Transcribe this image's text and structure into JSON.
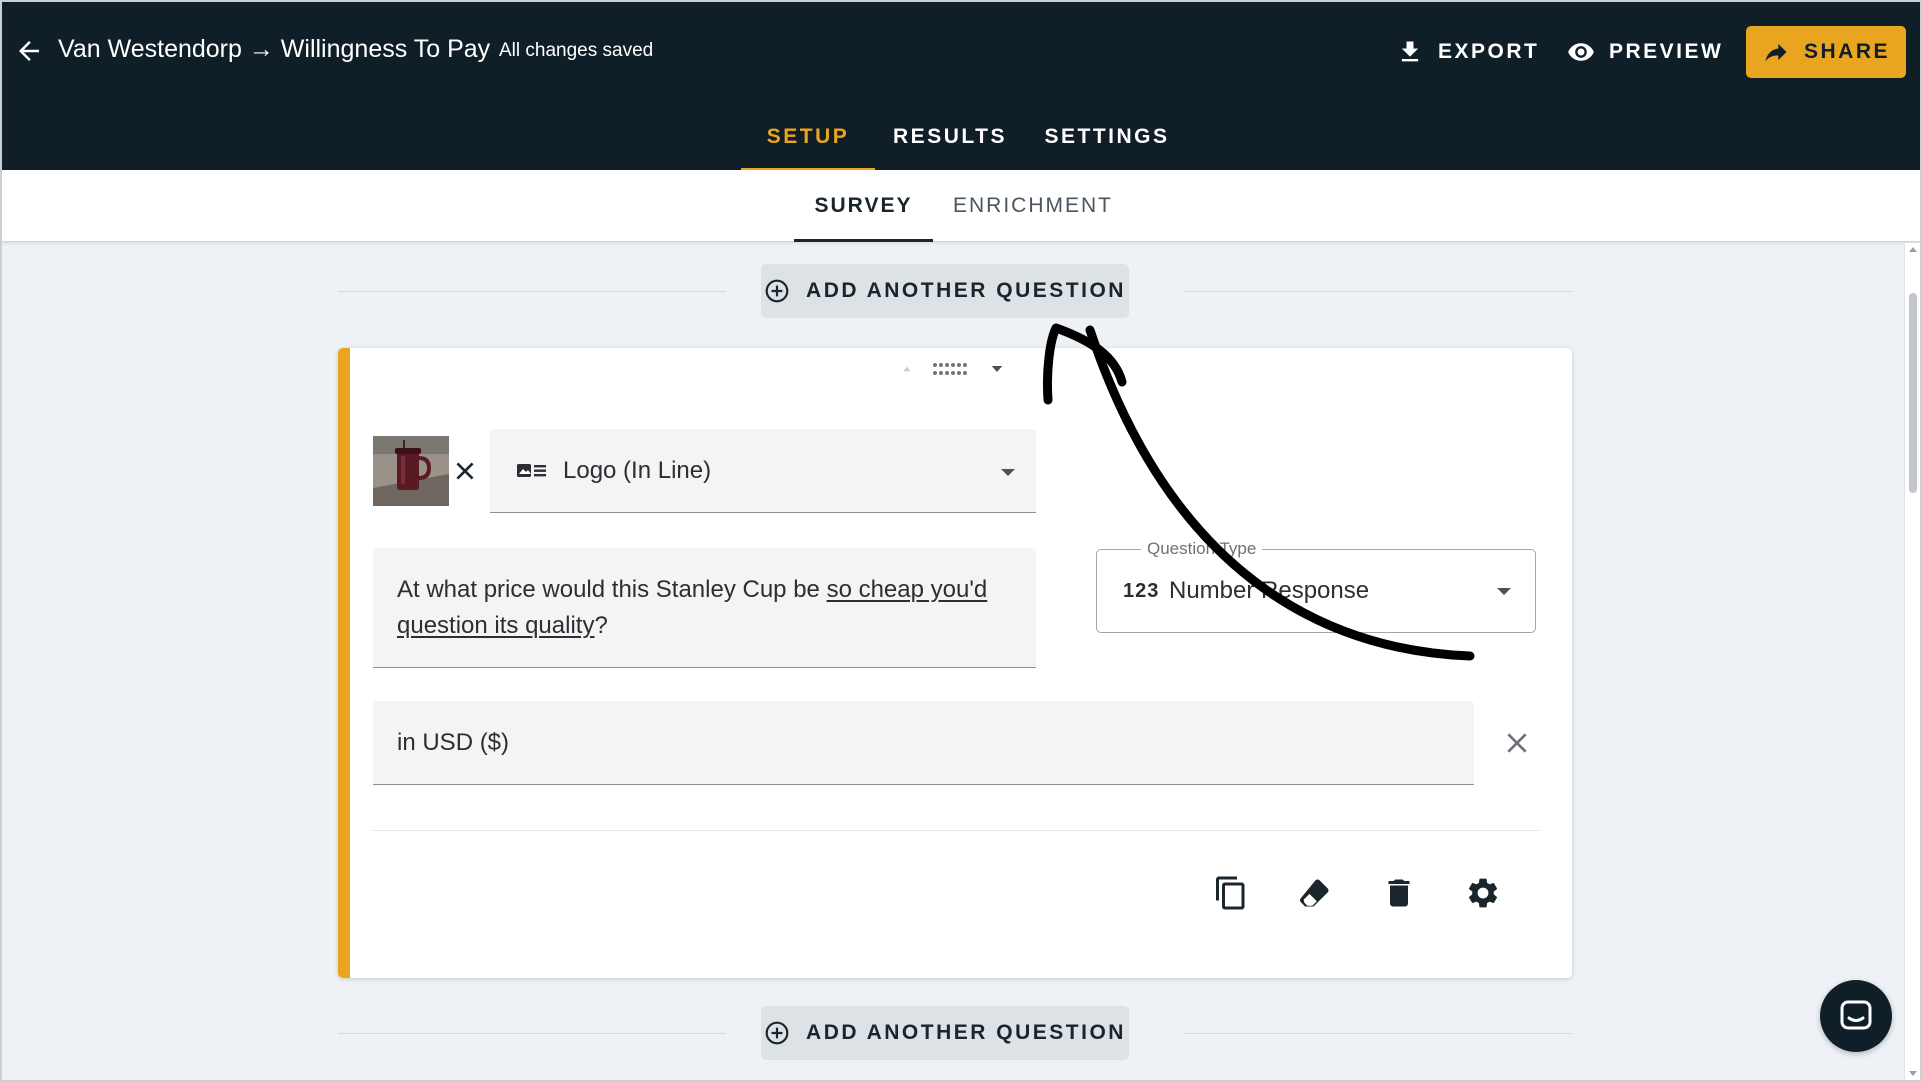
{
  "header": {
    "title": "Van Westendorp → Willingness To Pay",
    "save_status": "All changes saved",
    "actions": {
      "export": "EXPORT",
      "preview": "PREVIEW",
      "share": "SHARE"
    },
    "tabs": [
      {
        "label": "SETUP",
        "active": true
      },
      {
        "label": "RESULTS",
        "active": false
      },
      {
        "label": "SETTINGS",
        "active": false
      }
    ]
  },
  "sub_tabs": [
    {
      "label": "SURVEY",
      "active": true
    },
    {
      "label": "ENRICHMENT",
      "active": false
    }
  ],
  "add_question_label": "ADD ANOTHER QUESTION",
  "question_card": {
    "image_display": {
      "value": "Logo (In Line)",
      "icon": "image-text-icon"
    },
    "question": {
      "text_before": "At what price would this Stanley Cup be ",
      "text_underlined": "so cheap you'd question its quality",
      "text_after": "?"
    },
    "question_type": {
      "label": "Question Type",
      "icon_text": "123",
      "value": "Number Response"
    },
    "unit": {
      "value": "in USD ($)"
    },
    "tools": [
      "copy-icon",
      "eraser-icon",
      "trash-icon",
      "gear-icon"
    ]
  },
  "colors": {
    "header_bg": "#0f1e27",
    "accent": "#eaa520",
    "page_bg": "#eef2f6"
  }
}
